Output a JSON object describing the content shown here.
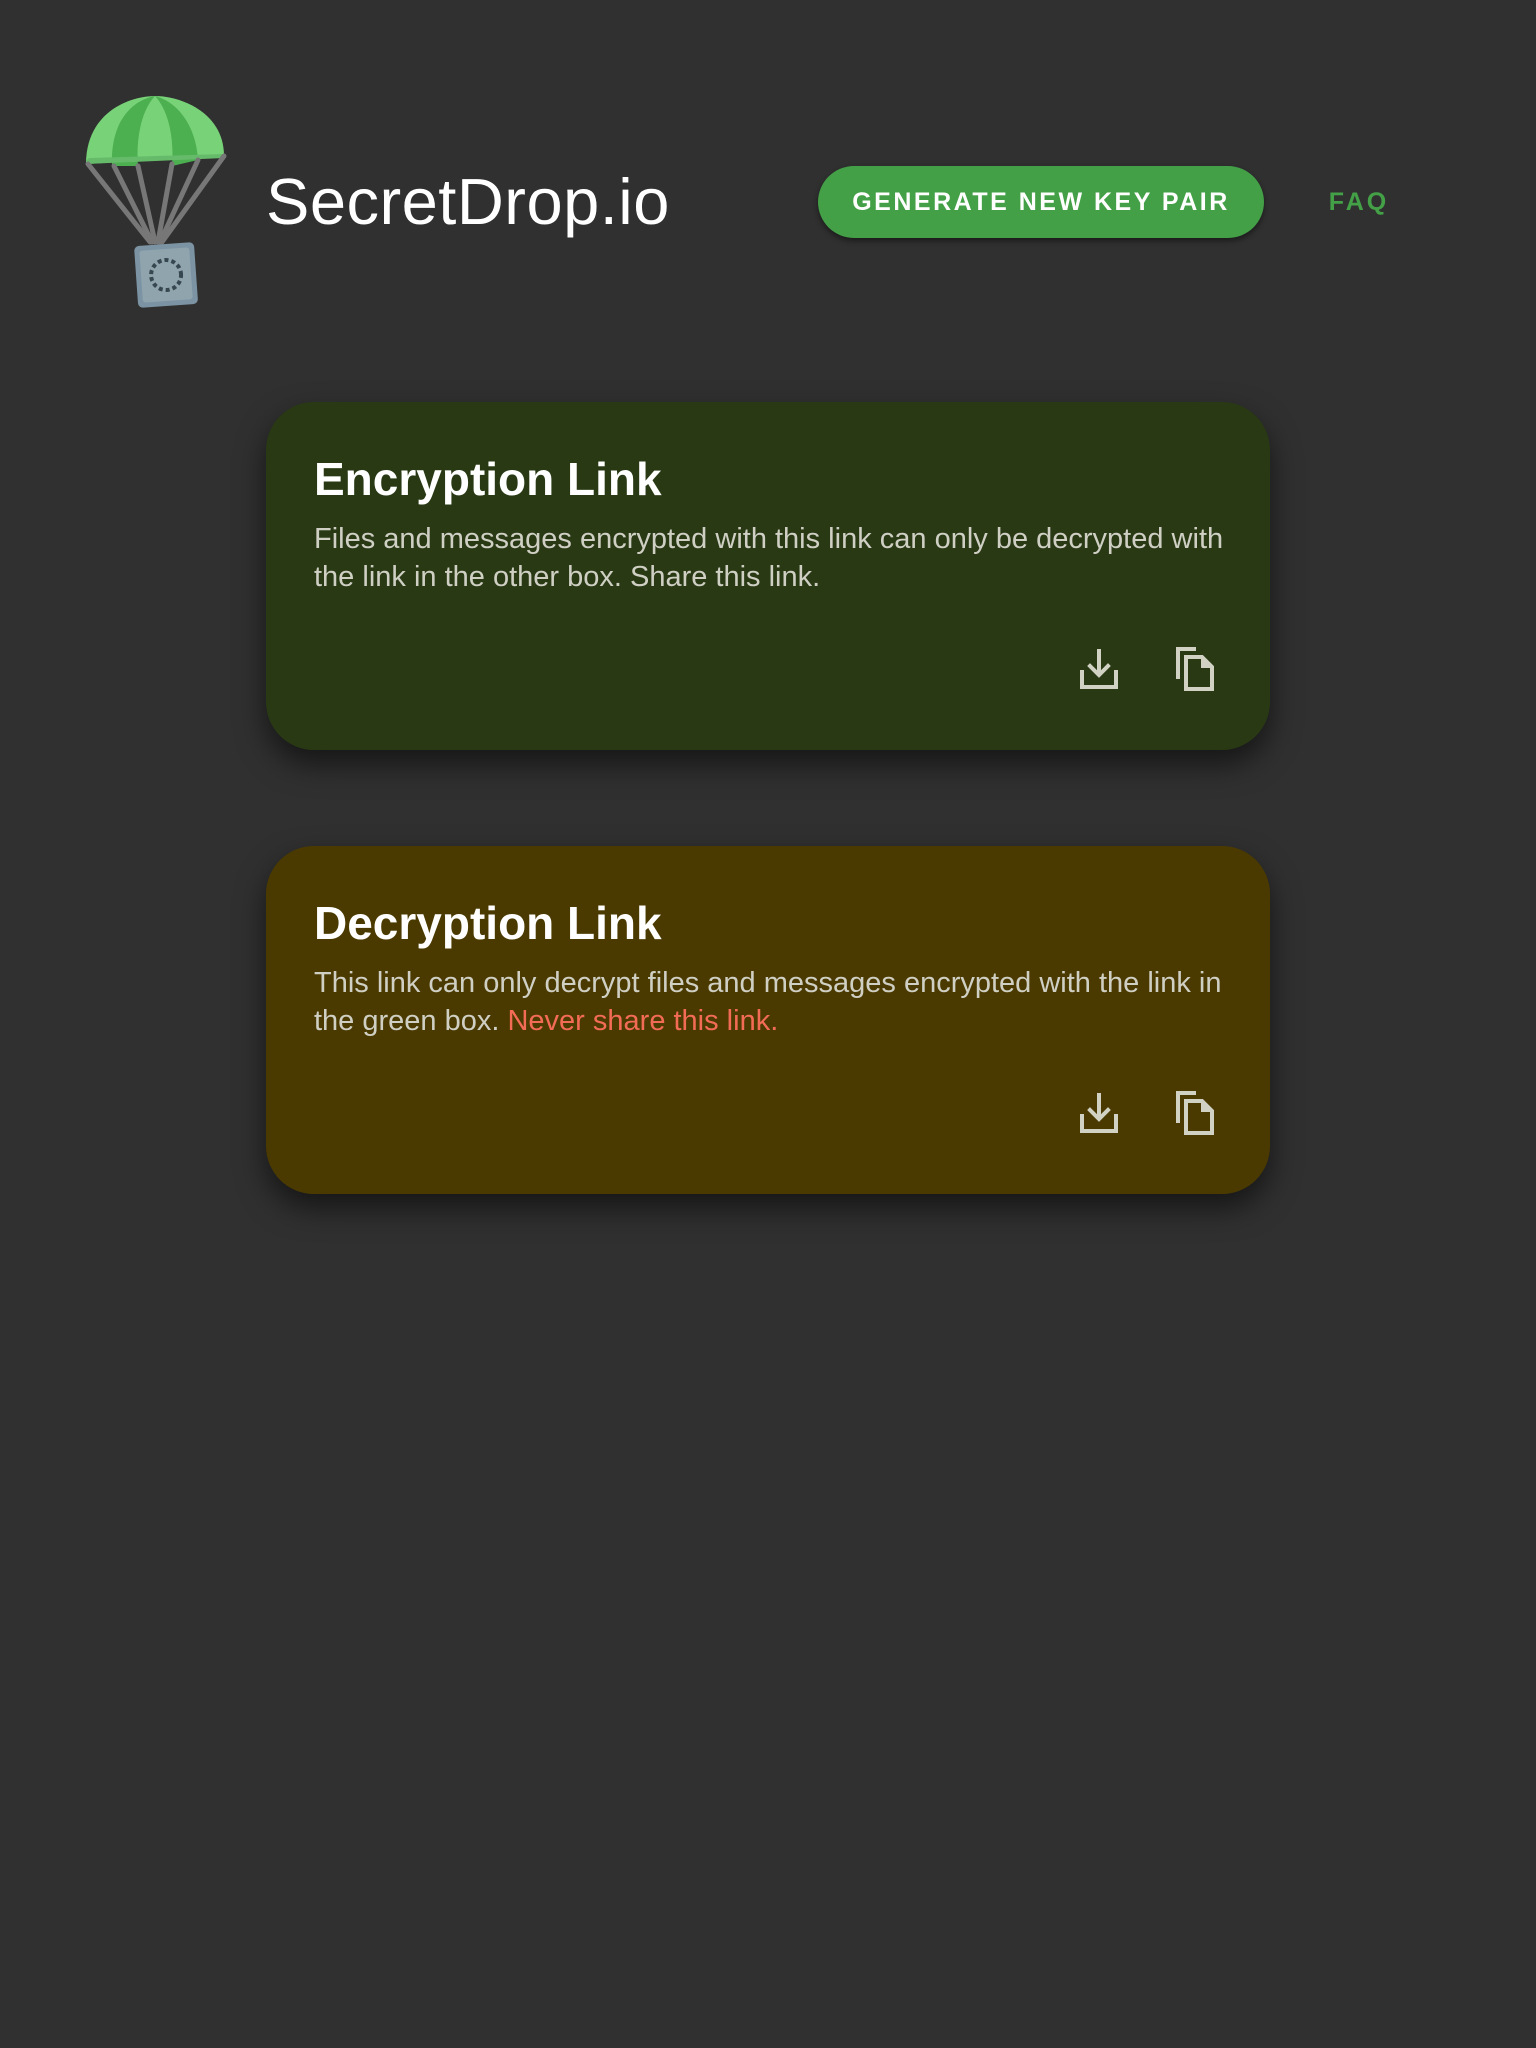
{
  "header": {
    "title": "SecretDrop.io",
    "generate_button_label": "GENERATE NEW KEY PAIR",
    "faq_label": "FAQ"
  },
  "colors": {
    "background": "#303030",
    "accent_green": "#43a047",
    "encryption_card": "#283914",
    "decryption_card": "#4b3a00",
    "warning": "#f26b55"
  },
  "encryption_card": {
    "title": "Encryption Link",
    "description": "Files and messages encrypted with this link can only be decrypted with the link in the other box. Share this link.",
    "actions": [
      "download-icon",
      "copy-icon"
    ]
  },
  "decryption_card": {
    "title": "Decryption Link",
    "description": "This link can only decrypt files and messages encrypted with the link in the green box.",
    "warning": "Never share this link.",
    "actions": [
      "download-icon",
      "copy-icon"
    ]
  },
  "icons": {
    "logo": "parachute-safe-logo",
    "download": "download-icon",
    "copy": "copy-icon"
  }
}
